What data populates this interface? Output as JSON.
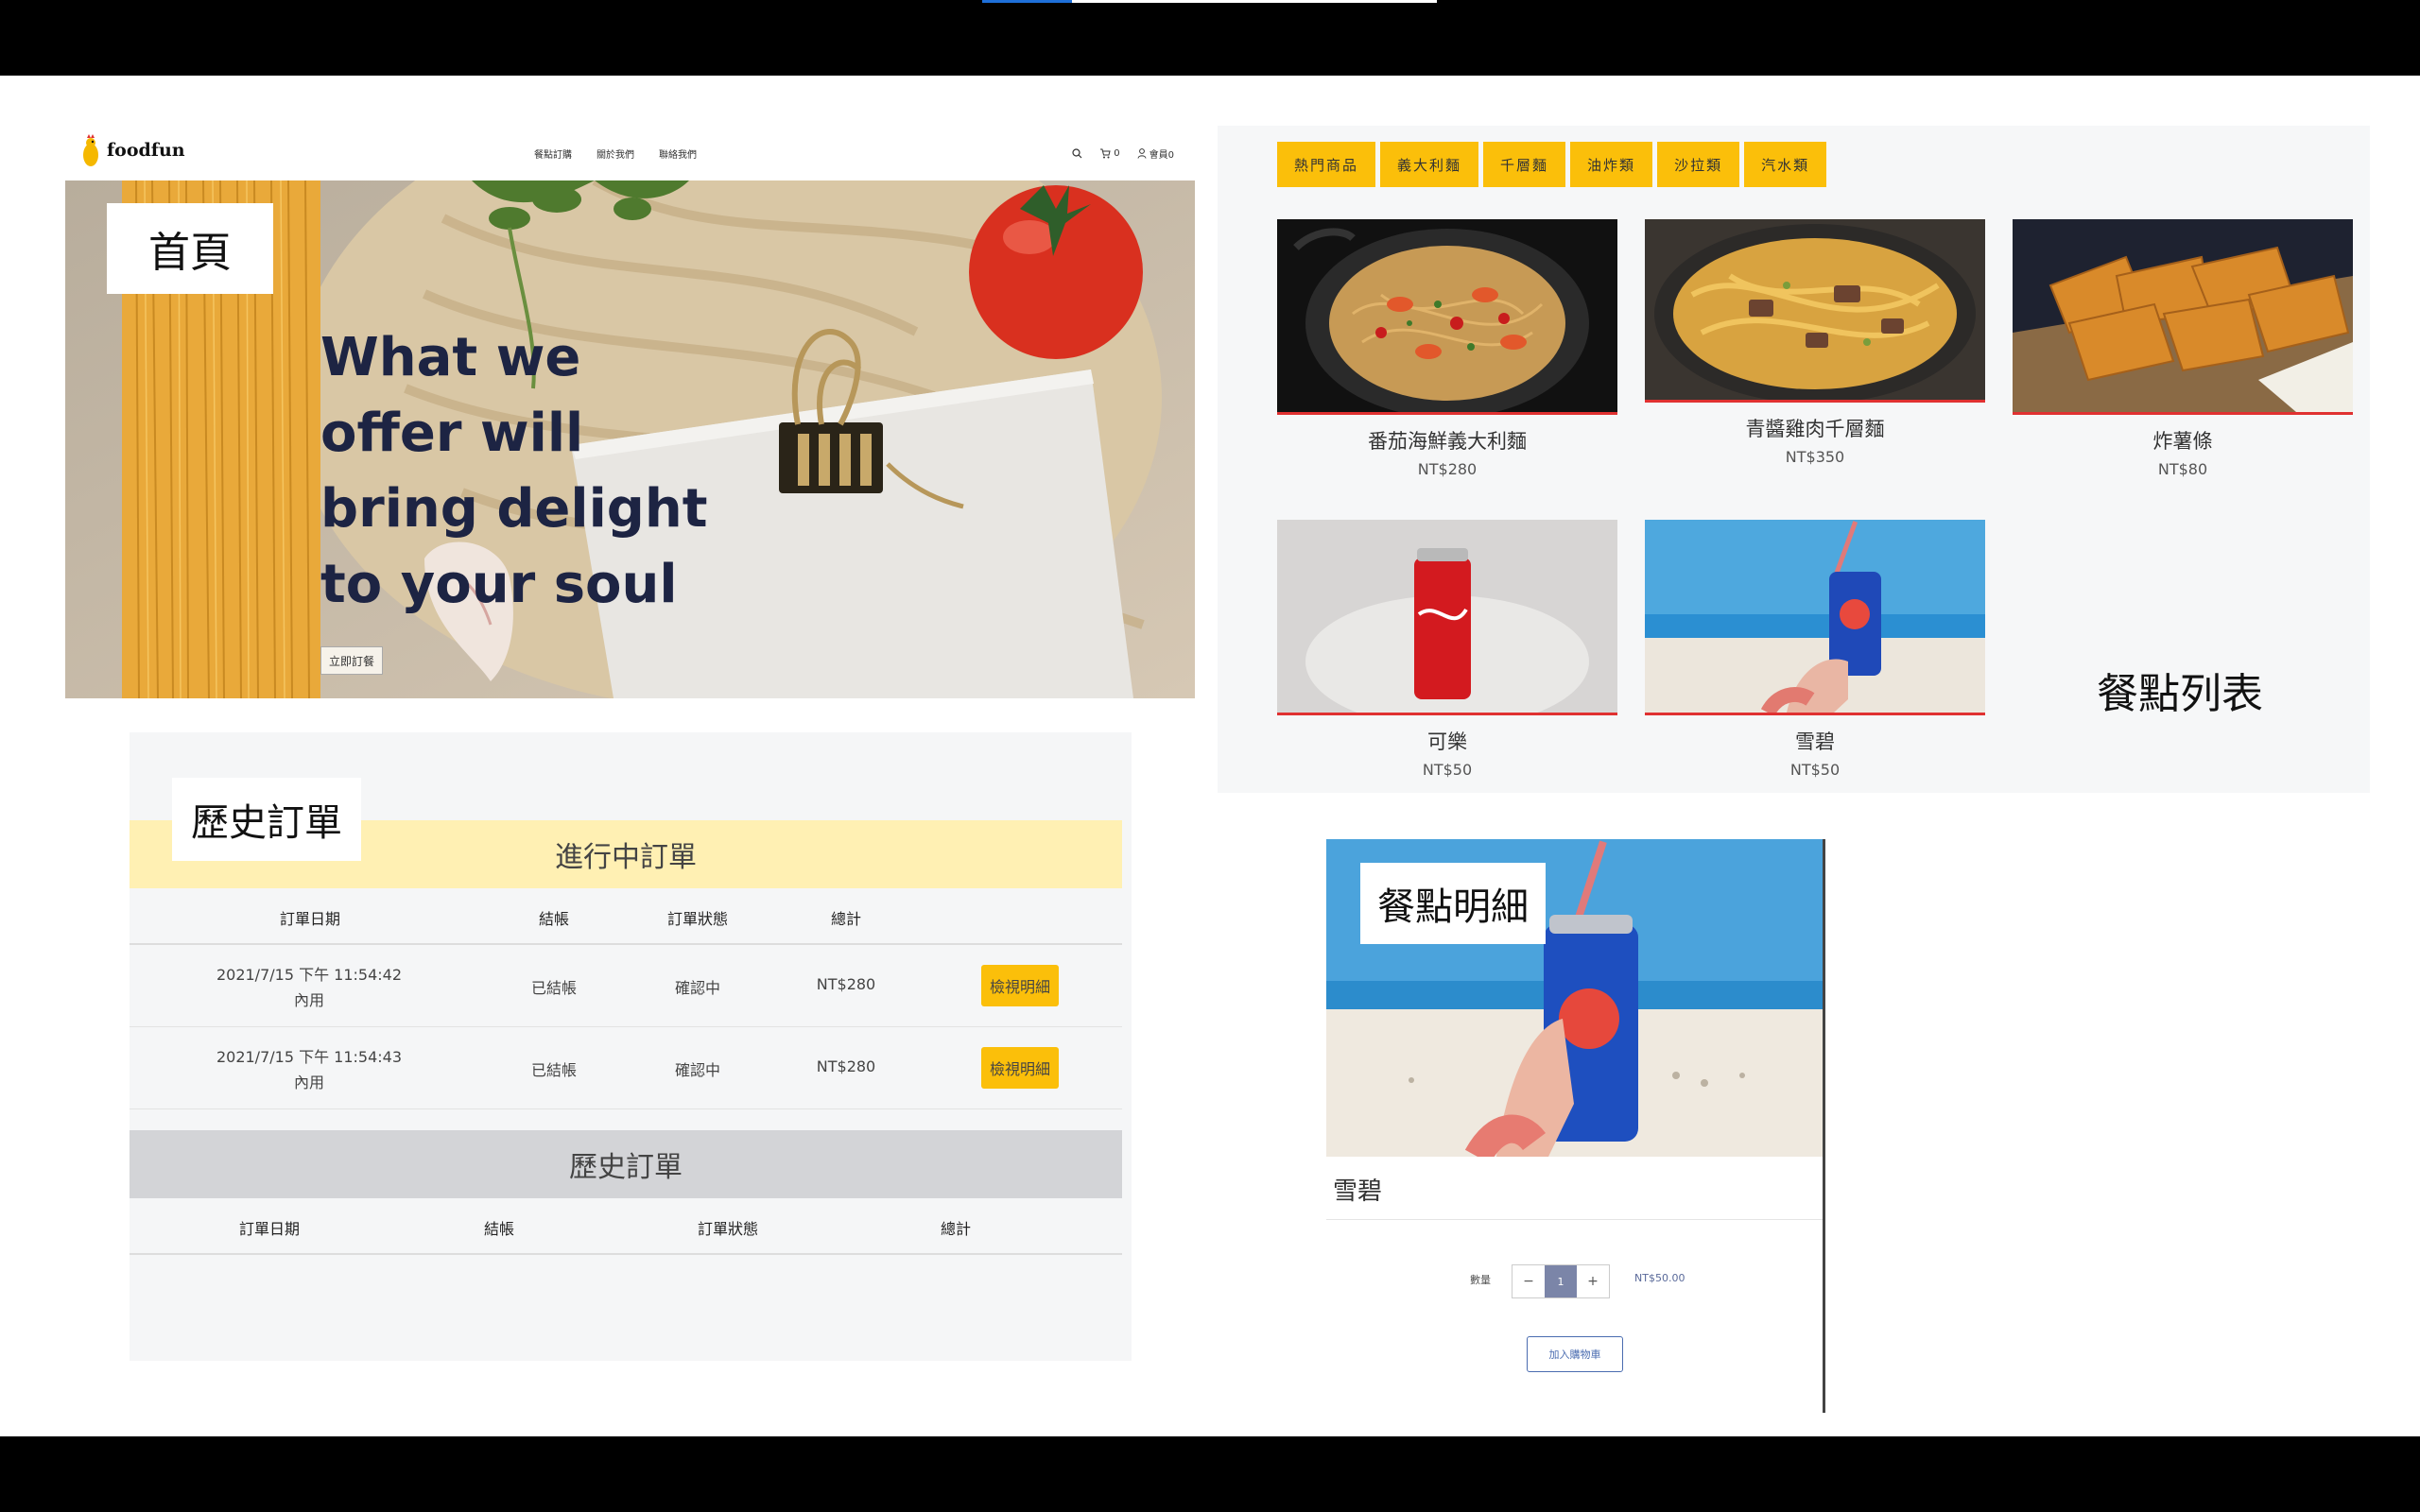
{
  "home": {
    "label": "首頁",
    "brand": "foodfun",
    "nav_links": [
      "餐點訂購",
      "關於我們",
      "聯絡我們"
    ],
    "cart_count": "0",
    "member": "會員0",
    "hero_title": "What we offer will bring delight to your soul",
    "hero_button": "立即訂餐"
  },
  "menu": {
    "label": "餐點列表",
    "categories": [
      "熱門商品",
      "義大利麵",
      "千層麵",
      "油炸類",
      "沙拉類",
      "汽水類"
    ],
    "items": [
      {
        "name": "番茄海鮮義大利麵",
        "price": "NT$280"
      },
      {
        "name": "青醬雞肉千層麵",
        "price": "NT$350"
      },
      {
        "name": "炸薯條",
        "price": "NT$80"
      },
      {
        "name": "可樂",
        "price": "NT$50"
      },
      {
        "name": "雪碧",
        "price": "NT$50"
      }
    ]
  },
  "history": {
    "label": "歷史訂單",
    "ongoing_title": "進行中訂單",
    "ongoing_headers": [
      "訂單日期",
      "結帳",
      "訂單狀態",
      "總計"
    ],
    "ongoing_rows": [
      {
        "date": "2021/7/15 下午 11:54:42",
        "type": "內用",
        "paid": "已結帳",
        "status": "確認中",
        "total": "NT$280",
        "action": "檢視明細"
      },
      {
        "date": "2021/7/15 下午 11:54:43",
        "type": "內用",
        "paid": "已結帳",
        "status": "確認中",
        "total": "NT$280",
        "action": "檢視明細"
      }
    ],
    "history_title": "歷史訂單",
    "history_headers": [
      "訂單日期",
      "結帳",
      "訂單狀態",
      "總計"
    ]
  },
  "detail": {
    "label": "餐點明細",
    "name": "雪碧",
    "qty_label": "數量",
    "minus": "−",
    "qty": "1",
    "plus": "+",
    "price": "NT$50.00",
    "add_to_cart": "加入購物車"
  },
  "colors": {
    "accent": "#fbbf0a",
    "underline": "#e03131",
    "ongoing_bg": "#fff0b3",
    "history_bg": "#d3d4d7"
  }
}
